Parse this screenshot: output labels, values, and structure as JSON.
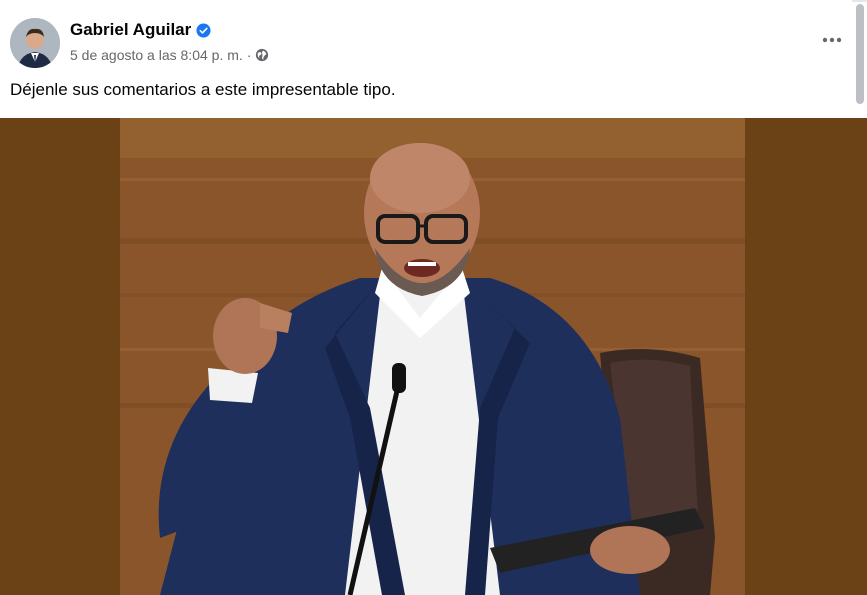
{
  "post": {
    "author": "Gabriel Aguilar",
    "date": "5 de agosto a las 8:04 p. m.",
    "separator": "·",
    "text": "Déjenle sus comentarios a este impresentable tipo.",
    "icons": {
      "verified": "verified-badge-icon",
      "privacy": "globe-icon",
      "more": "more-options-icon"
    }
  },
  "colors": {
    "verified_blue": "#1877f2",
    "media_background": "#6b4216",
    "text_primary": "#050505",
    "text_secondary": "#65676b"
  }
}
